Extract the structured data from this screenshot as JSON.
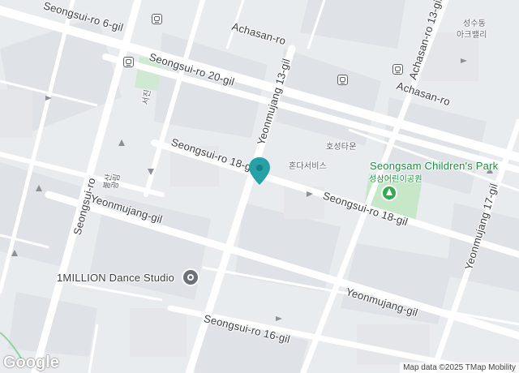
{
  "map": {
    "roads": [
      {
        "name": "Seongsui-ro 6-gil"
      },
      {
        "name": "Achasan-ro"
      },
      {
        "name": "Achasan-ro"
      },
      {
        "name": "Seongsui-ro 20-gil"
      },
      {
        "name": "Yeonmujang 13-gil"
      },
      {
        "name": "Achasan-ro 13-gil"
      },
      {
        "name": "Seongsui-ro 18-gil"
      },
      {
        "name": "Seongsui-ro 18-gil"
      },
      {
        "name": "Seongsui-ro"
      },
      {
        "name": "Yeonmujang-gil"
      },
      {
        "name": "Yeonmujang-gil"
      },
      {
        "name": "Yeonmujang 17-gil"
      },
      {
        "name": "Seongsui-ro 16-gil"
      }
    ],
    "korean_labels": [
      {
        "text": "성수동"
      },
      {
        "text": "아크밸리"
      },
      {
        "text": "서진"
      },
      {
        "text": "광림"
      },
      {
        "text": "볼산"
      },
      {
        "text": "호성타운"
      },
      {
        "text": "혼다서비스"
      }
    ],
    "park": {
      "name": "Seongsam Children's Park",
      "name_ko": "성삼어린이공원"
    },
    "poi": {
      "name": "1MILLION Dance Studio",
      "icon": "poi-icon"
    },
    "branding": {
      "logo": "Google",
      "attribution": "Map data ©2025 TMap Mobility"
    },
    "colors": {
      "road": "#ffffff",
      "block": "#dadde1",
      "pin": "#26a1a8",
      "park": "#c6e8c9"
    }
  }
}
